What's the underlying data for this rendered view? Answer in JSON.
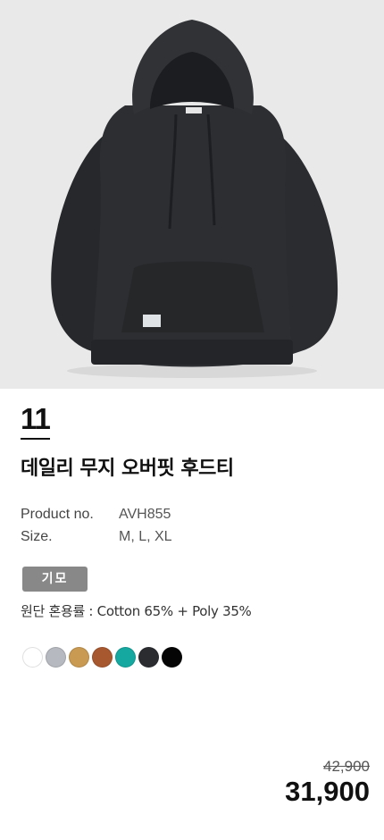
{
  "product": {
    "rank": "11",
    "title": "데일리 무지 오버핏 후드티",
    "specs": [
      {
        "label": "Product no.",
        "value": "AVH855"
      },
      {
        "label": "Size.",
        "value": "M, L, XL"
      }
    ],
    "badge": "기모",
    "fabric": "원단 혼용률 : Cotton 65% + Poly 35%",
    "colors": [
      "#ffffff",
      "#b6b9bf",
      "#c99a52",
      "#a8582f",
      "#14a8a0",
      "#2a2c30",
      "#050505"
    ],
    "original_price": "42,900",
    "sale_price": "31,900"
  }
}
